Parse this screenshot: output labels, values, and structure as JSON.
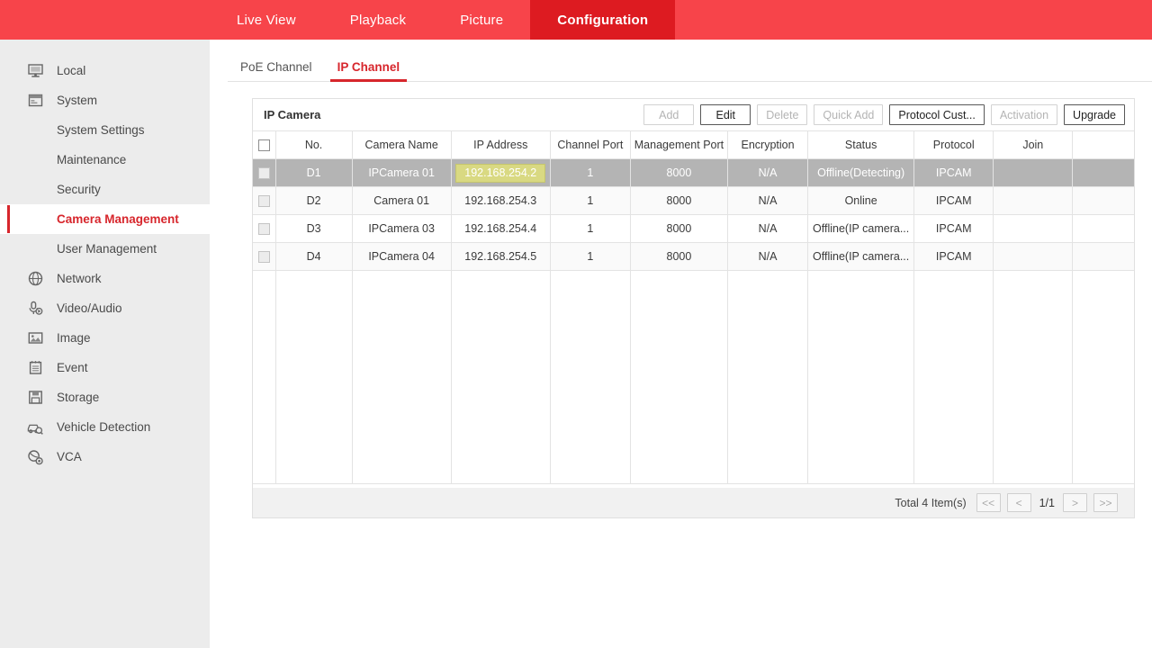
{
  "topnav": {
    "tabs": [
      {
        "label": "Live View",
        "active": false
      },
      {
        "label": "Playback",
        "active": false
      },
      {
        "label": "Picture",
        "active": false
      },
      {
        "label": "Configuration",
        "active": true
      }
    ]
  },
  "sidebar": {
    "items": [
      {
        "label": "Local",
        "icon": "monitor-icon",
        "key": "local"
      },
      {
        "label": "System",
        "icon": "window-icon",
        "key": "system"
      },
      {
        "label": "System Settings",
        "icon": "",
        "key": "system-settings"
      },
      {
        "label": "Maintenance",
        "icon": "",
        "key": "maintenance"
      },
      {
        "label": "Security",
        "icon": "",
        "key": "security"
      },
      {
        "label": "Camera Management",
        "icon": "",
        "key": "camera-management"
      },
      {
        "label": "User Management",
        "icon": "",
        "key": "user-management"
      },
      {
        "label": "Network",
        "icon": "globe-icon",
        "key": "network"
      },
      {
        "label": "Video/Audio",
        "icon": "microphone-icon",
        "key": "video-audio"
      },
      {
        "label": "Image",
        "icon": "picture-icon",
        "key": "image"
      },
      {
        "label": "Event",
        "icon": "notepad-icon",
        "key": "event"
      },
      {
        "label": "Storage",
        "icon": "floppy-icon",
        "key": "storage"
      },
      {
        "label": "Vehicle Detection",
        "icon": "car-search-icon",
        "key": "vehicle-detection"
      },
      {
        "label": "VCA",
        "icon": "vca-icon",
        "key": "vca"
      }
    ]
  },
  "subtabs": [
    {
      "label": "PoE Channel",
      "active": false
    },
    {
      "label": "IP Channel",
      "active": true
    }
  ],
  "panel": {
    "title": "IP Camera",
    "buttons": [
      {
        "label": "Add",
        "enabled": false
      },
      {
        "label": "Edit",
        "enabled": true
      },
      {
        "label": "Delete",
        "enabled": false
      },
      {
        "label": "Quick Add",
        "enabled": false
      },
      {
        "label": "Protocol Cust...",
        "enabled": true
      },
      {
        "label": "Activation",
        "enabled": false
      },
      {
        "label": "Upgrade",
        "enabled": true
      }
    ],
    "columns": [
      "No.",
      "Camera Name",
      "IP Address",
      "Channel Port",
      "Management Port",
      "Encryption",
      "Status",
      "Protocol",
      "Join",
      ""
    ],
    "rows": [
      {
        "no": "D1",
        "camera_name": "IPCamera 01",
        "ip_address": "192.168.254.2",
        "channel_port": "1",
        "management_port": "8000",
        "encryption": "N/A",
        "status": "Offline(Detecting)",
        "protocol": "IPCAM",
        "join": "",
        "extra": "",
        "selected": true,
        "ip_highlighted": true
      },
      {
        "no": "D2",
        "camera_name": "Camera 01",
        "ip_address": "192.168.254.3",
        "channel_port": "1",
        "management_port": "8000",
        "encryption": "N/A",
        "status": "Online",
        "protocol": "IPCAM",
        "join": "",
        "extra": "",
        "selected": false,
        "ip_highlighted": false
      },
      {
        "no": "D3",
        "camera_name": "IPCamera 03",
        "ip_address": "192.168.254.4",
        "channel_port": "1",
        "management_port": "8000",
        "encryption": "N/A",
        "status": "Offline(IP camera...",
        "protocol": "IPCAM",
        "join": "",
        "extra": "",
        "selected": false,
        "ip_highlighted": false
      },
      {
        "no": "D4",
        "camera_name": "IPCamera 04",
        "ip_address": "192.168.254.5",
        "channel_port": "1",
        "management_port": "8000",
        "encryption": "N/A",
        "status": "Offline(IP camera...",
        "protocol": "IPCAM",
        "join": "",
        "extra": "",
        "selected": false,
        "ip_highlighted": false
      }
    ],
    "pagination": {
      "total_label": "Total 4 Item(s)",
      "first_label": "<<",
      "prev_label": "<",
      "page_label": "1/1",
      "next_label": ">",
      "last_label": ">>"
    }
  },
  "colors": {
    "nav_bg": "#f7444a",
    "nav_active_bg": "#dd1b21",
    "accent": "#d7262c",
    "sidebar_bg": "#ececec",
    "row_selected_bg": "#b4b4b4",
    "highlight_cell_bg": "#d9d982"
  }
}
